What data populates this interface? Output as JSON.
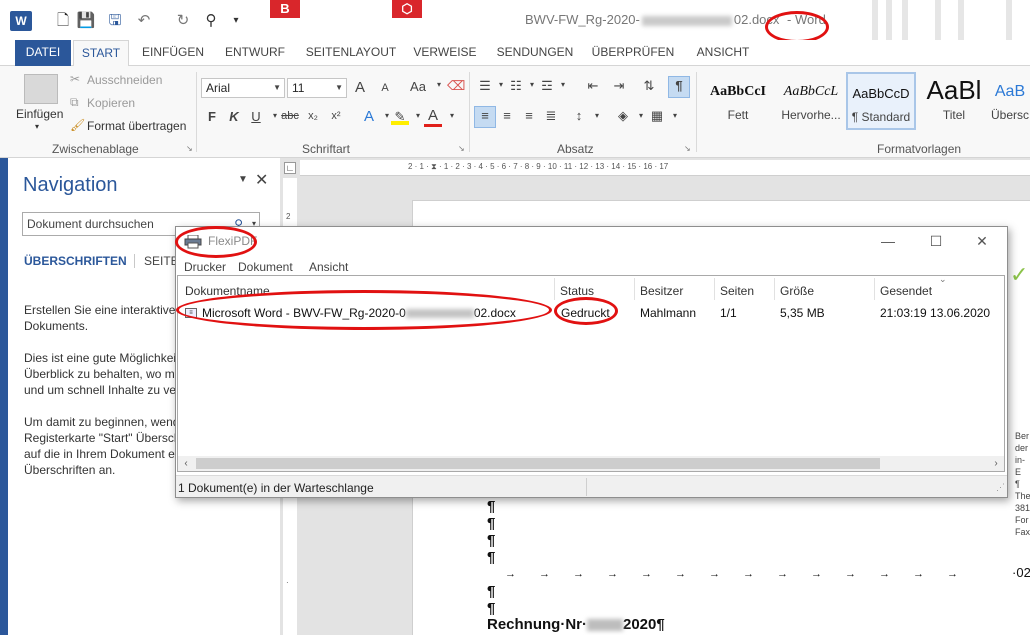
{
  "word": {
    "title_prefix": "BWV-FW_Rg-2020-",
    "title_suffix": "02.docx",
    "app_name": "- Word",
    "qat": {
      "undo_icon": "undo-icon",
      "redo_icon": "redo-icon",
      "save_icon": "save-icon"
    },
    "tabs": [
      "DATEI",
      "START",
      "EINFÜGEN",
      "ENTWURF",
      "SEITENLAYOUT",
      "VERWEISE",
      "SENDUNGEN",
      "ÜBERPRÜFEN",
      "ANSICHT"
    ],
    "active_tab": "START"
  },
  "ribbon": {
    "clipboard": {
      "paste": "Einfügen",
      "cut": "Ausschneiden",
      "copy": "Kopieren",
      "format_painter": "Format übertragen",
      "label": "Zwischenablage"
    },
    "font": {
      "name": "Arial",
      "size": "11",
      "label": "Schriftart",
      "grow": "A",
      "shrink": "A",
      "case": "Aa",
      "bold": "F",
      "italic": "K",
      "underline": "U",
      "strike": "abc",
      "sub": "x₂",
      "sup": "x²"
    },
    "paragraph": {
      "label": "Absatz",
      "pilcrow": "¶"
    },
    "styles": {
      "label": "Formatvorlagen",
      "items": [
        {
          "preview": "AaBbCcI",
          "name": "Fett"
        },
        {
          "preview": "AaBbCcL",
          "name": "Hervorhe..."
        },
        {
          "preview": "AaBbCcD",
          "name": "¶ Standard"
        },
        {
          "preview": "AaBl",
          "name": "Titel"
        },
        {
          "preview": "AaB",
          "name": "Übersc"
        }
      ]
    }
  },
  "navigation": {
    "title": "Navigation",
    "search_placeholder": "Dokument durchsuchen",
    "tab_headings": "ÜBERSCHRIFTEN",
    "tab_pages": "SEITEN",
    "para1": "Erstellen Sie eine interaktive G\nDokuments.",
    "para2": "Dies ist eine gute Möglichkeit\nÜberblick zu behalten, wo ma\nund um schnell Inhalte zu ver",
    "para3": "Um damit zu beginnen, wend\nRegisterkarte \"Start\" Überschri\nauf die in Ihrem Dokument e\nÜberschriften an."
  },
  "document": {
    "pilcrow": "¶",
    "tab_arrows": "→→→→→→→→→→→→→→",
    "tab_end": "02",
    "rechnung_prefix": "Rechnung·Nr·",
    "rechnung_suffix": "2020¶",
    "side_text": "Ber\nder\nin-E\n¶\nThe\n381\nFor\nFax"
  },
  "flexipdf": {
    "title": "FlexiPDF",
    "menu": [
      "Drucker",
      "Dokument",
      "Ansicht"
    ],
    "columns": [
      "Dokumentname",
      "Status",
      "Besitzer",
      "Seiten",
      "Größe",
      "Gesendet"
    ],
    "job": {
      "name_prefix": "Microsoft Word - BWV-FW_Rg-2020-0",
      "name_suffix": "02.docx",
      "status": "Gedruckt",
      "owner": "Mahlmann",
      "pages": "1/1",
      "size": "5,35 MB",
      "sent": "21:03:19  13.06.2020"
    },
    "status_bar": "1 Dokument(e) in der Warteschlange"
  },
  "colors": {
    "word_blue": "#2b579a",
    "annotation_red": "#e11111",
    "ribbon_bg": "#f8f8f8"
  }
}
